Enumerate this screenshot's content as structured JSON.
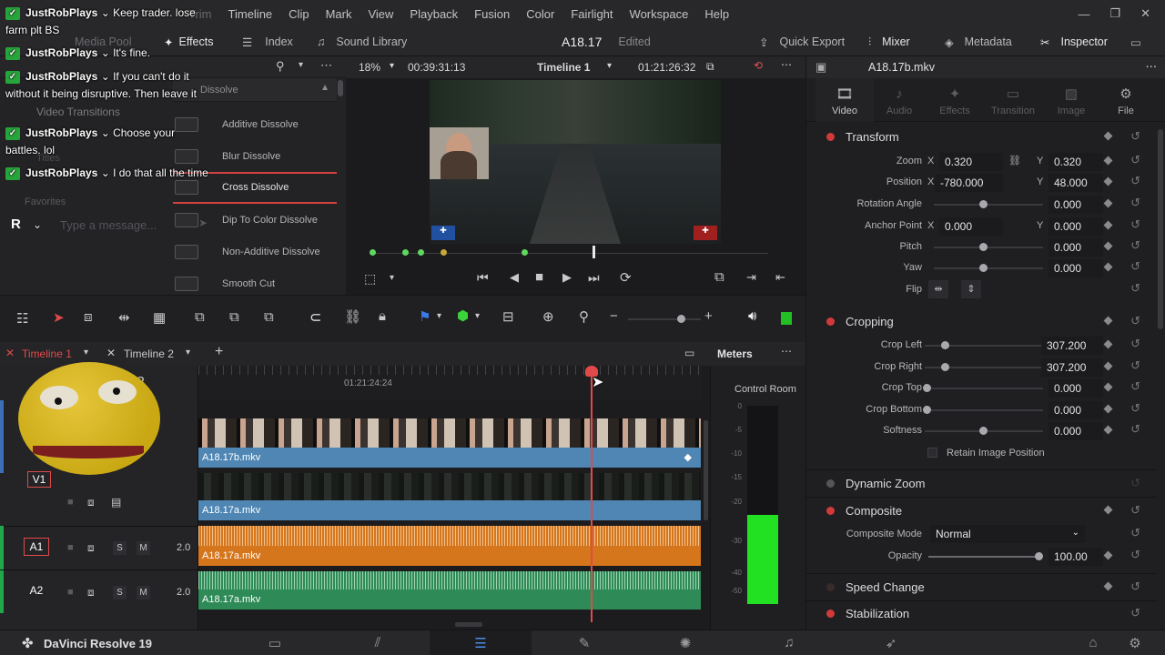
{
  "menu": {
    "items": [
      "Trim",
      "Timeline",
      "Clip",
      "Mark",
      "View",
      "Playback",
      "Fusion",
      "Color",
      "Fairlight",
      "Workspace",
      "Help"
    ]
  },
  "toolbar": {
    "media_pool": "Media Pool",
    "effects": "Effects",
    "index": "Index",
    "sound_library": "Sound Library",
    "project_name": "A18.17",
    "status": "Edited",
    "quick_export": "Quick Export",
    "mixer": "Mixer",
    "metadata": "Metadata",
    "inspector": "Inspector"
  },
  "effects": {
    "header": "Dissolve",
    "category_video_transitions": "Video Transitions",
    "category_titles": "Titles",
    "category_favorites": "Favorites",
    "items": [
      "Additive Dissolve",
      "Blur Dissolve",
      "Cross Dissolve",
      "Dip To Color Dissolve",
      "Non-Additive Dissolve",
      "Smooth Cut"
    ],
    "selected": "Cross Dissolve"
  },
  "viewer": {
    "zoom": "18%",
    "source_tc": "00:39:31:13",
    "timeline_name": "Timeline 1",
    "record_tc": "01:21:26:32",
    "overlay_left": "✚",
    "overlay_right": "✚"
  },
  "inspector": {
    "clip_name": "A18.17b.mkv",
    "tabs": [
      "Video",
      "Audio",
      "Effects",
      "Transition",
      "Image",
      "File"
    ],
    "transform": {
      "title": "Transform",
      "zoom_label": "Zoom",
      "zoom_x": "0.320",
      "zoom_y": "0.320",
      "position_label": "Position",
      "pos_x": "-780.000",
      "pos_y": "48.000",
      "rotation_label": "Rotation Angle",
      "rotation": "0.000",
      "anchor_label": "Anchor Point",
      "anchor_x": "0.000",
      "anchor_y": "0.000",
      "pitch_label": "Pitch",
      "pitch": "0.000",
      "yaw_label": "Yaw",
      "yaw": "0.000",
      "flip_label": "Flip",
      "x": "X",
      "y": "Y"
    },
    "cropping": {
      "title": "Cropping",
      "left_label": "Crop Left",
      "left": "307.200",
      "right_label": "Crop Right",
      "right": "307.200",
      "top_label": "Crop Top",
      "top": "0.000",
      "bottom_label": "Crop Bottom",
      "bottom": "0.000",
      "softness_label": "Softness",
      "softness": "0.000",
      "retain_label": "Retain Image Position"
    },
    "dynamic_zoom": "Dynamic Zoom",
    "composite": {
      "title": "Composite",
      "mode_label": "Composite Mode",
      "mode": "Normal",
      "opacity_label": "Opacity",
      "opacity": "100.00"
    },
    "speed_change": "Speed Change",
    "stabilization": "Stabilization"
  },
  "timeline": {
    "tabs": [
      "Timeline 1",
      "Timeline 2"
    ],
    "meters_label": "Meters",
    "ruler_tc": "01:21:24:24",
    "track_num": "2",
    "clips": {
      "v2": "A18.17b.mkv",
      "v1": "A18.17a.mkv",
      "a1": "A18.17a.mkv",
      "a2": "A18.17a.mkv"
    },
    "tracks": {
      "v1": "V1",
      "a1": "A1",
      "a2": "A2",
      "a1_level": "2.0",
      "a2_level": "2.0",
      "solo": "S",
      "mute": "M"
    }
  },
  "meters": {
    "control_room": "Control Room",
    "scale": [
      "0",
      "-5",
      "-10",
      "-15",
      "-20",
      "-30",
      "-40",
      "-50"
    ],
    "level": 0.45
  },
  "chat": {
    "messages": [
      {
        "user": "JustRobPlays",
        "text": "Keep trader. lose farm plt BS"
      },
      {
        "user": "JustRobPlays",
        "text": "It's fine."
      },
      {
        "user": "JustRobPlays",
        "text": "If you can't do it without it being disruptive. Then leave it"
      },
      {
        "user": "JustRobPlays",
        "text": "Choose your battles. lol"
      },
      {
        "user": "JustRobPlays",
        "text": "I do that all the time"
      }
    ],
    "avatar_letter": "R",
    "placeholder": "Type a message..."
  },
  "bottombar": {
    "app_name": "DaVinci Resolve 19"
  },
  "colors": {
    "accent": "#d64040",
    "video_clip": "#4f86b3",
    "audio1": "#d5761c",
    "audio2": "#2e8b57",
    "meter": "#22e022"
  }
}
